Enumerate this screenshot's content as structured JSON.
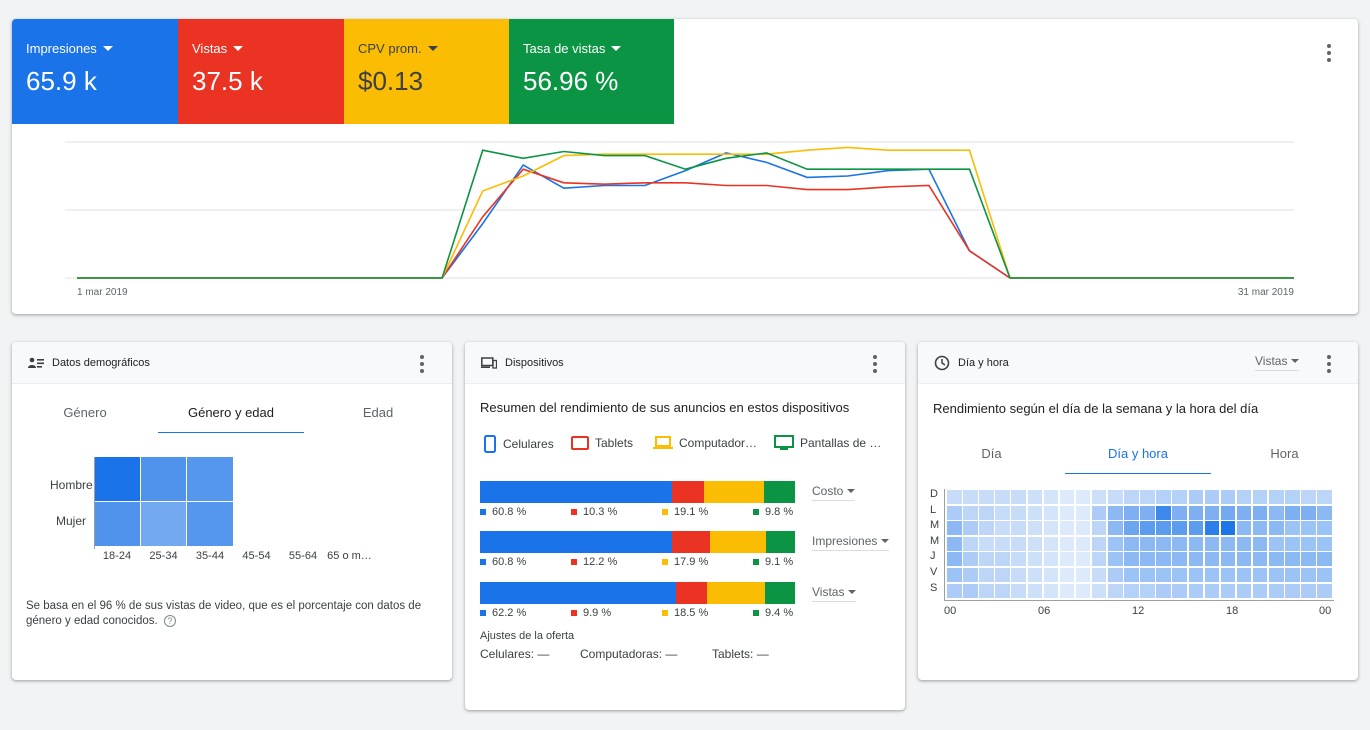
{
  "metrics": [
    {
      "label": "Impresiones",
      "value": "65.9 k",
      "color": "#1a73e8",
      "text_color": "#ffffff"
    },
    {
      "label": "Vistas",
      "value": "37.5 k",
      "color": "#ea3323",
      "text_color": "#ffffff"
    },
    {
      "label": "CPV prom.",
      "value": "$0.13",
      "color": "#fbbc04",
      "text_color": "#3c4043"
    },
    {
      "label": "Tasa de vistas",
      "value": "56.96 %",
      "color": "#0b9444",
      "text_color": "#ffffff"
    }
  ],
  "chart_data": {
    "type": "line",
    "x_start_label": "1 mar 2019",
    "x_end_label": "31 mar 2019",
    "x": [
      1,
      2,
      3,
      4,
      5,
      6,
      7,
      8,
      9,
      10,
      11,
      12,
      13,
      14,
      15,
      16,
      17,
      18,
      19,
      20,
      21,
      22,
      23,
      24,
      25,
      26,
      27,
      28,
      29,
      30,
      31
    ],
    "ylim": [
      0,
      1
    ],
    "series": [
      {
        "color": "#1a73e8",
        "values": [
          0,
          0,
          0,
          0,
          0,
          0,
          0,
          0,
          0,
          0,
          0.4,
          0.83,
          0.66,
          0.68,
          0.68,
          0.79,
          0.92,
          0.85,
          0.74,
          0.75,
          0.79,
          0.8,
          0.2,
          0,
          0,
          0,
          0,
          0,
          0,
          0,
          0
        ]
      },
      {
        "color": "#ea3323",
        "values": [
          0,
          0,
          0,
          0,
          0,
          0,
          0,
          0,
          0,
          0,
          0.45,
          0.8,
          0.7,
          0.69,
          0.7,
          0.7,
          0.68,
          0.68,
          0.65,
          0.65,
          0.67,
          0.68,
          0.2,
          0,
          0,
          0,
          0,
          0,
          0,
          0,
          0
        ]
      },
      {
        "color": "#fbbc04",
        "values": [
          0,
          0,
          0,
          0,
          0,
          0,
          0,
          0,
          0,
          0,
          0.64,
          0.75,
          0.9,
          0.91,
          0.91,
          0.91,
          0.91,
          0.91,
          0.94,
          0.96,
          0.94,
          0.94,
          0.94,
          0,
          0,
          0,
          0,
          0,
          0,
          0,
          0
        ]
      },
      {
        "color": "#0b9444",
        "values": [
          0,
          0,
          0,
          0,
          0,
          0,
          0,
          0,
          0,
          0,
          0.94,
          0.88,
          0.93,
          0.9,
          0.9,
          0.8,
          0.88,
          0.92,
          0.8,
          0.8,
          0.8,
          0.8,
          0.8,
          0,
          0,
          0,
          0,
          0,
          0,
          0,
          0
        ]
      }
    ]
  },
  "demo": {
    "title": "Datos demográficos",
    "tabs": [
      "Género",
      "Género y edad",
      "Edad"
    ],
    "rows": [
      "Hombre",
      "Mujer"
    ],
    "cols": [
      "18-24",
      "25-34",
      "35-44",
      "45-54",
      "55-64",
      "65 o m…"
    ],
    "heat": [
      [
        1.0,
        0.65,
        0.6,
        0,
        0,
        0
      ],
      [
        0.65,
        0.4,
        0.6,
        0,
        0,
        0
      ]
    ],
    "note": "Se basa en el 96 % de sus vistas de video, que es el porcentaje con datos de género y edad conocidos."
  },
  "devices": {
    "title": "Dispositivos",
    "subtitle": "Resumen del rendimiento de sus anuncios en estos dispositivos",
    "legend": [
      {
        "label": "Celulares",
        "color": "#1a73e8"
      },
      {
        "label": "Tablets",
        "color": "#ea3323"
      },
      {
        "label": "Computador…",
        "color": "#fbbc04"
      },
      {
        "label": "Pantallas de …",
        "color": "#0b9444"
      }
    ],
    "rows": [
      {
        "metric": "Costo",
        "values": [
          60.8,
          10.3,
          19.1,
          9.8
        ],
        "labels": [
          "60.8 %",
          "10.3 %",
          "19.1 %",
          "9.8 %"
        ]
      },
      {
        "metric": "Impresiones",
        "values": [
          60.8,
          12.2,
          17.9,
          9.1
        ],
        "labels": [
          "60.8 %",
          "12.2 %",
          "17.9 %",
          "9.1 %"
        ]
      },
      {
        "metric": "Vistas",
        "values": [
          62.2,
          9.9,
          18.5,
          9.4
        ],
        "labels": [
          "62.2 %",
          "9.9 %",
          "18.5 %",
          "9.4 %"
        ]
      }
    ],
    "bid_title": "Ajustes de la oferta",
    "bids": [
      "Celulares: —",
      "Computadoras: —",
      "Tablets: —"
    ]
  },
  "dayhour": {
    "title": "Día y hora",
    "metric_select": "Vistas",
    "subtitle": "Rendimiento según el día de la semana y la hora del día",
    "tabs": [
      "Día",
      "Día y hora",
      "Hora"
    ],
    "days": [
      "D",
      "L",
      "M",
      "M",
      "J",
      "V",
      "S"
    ],
    "hour_ticks": [
      "00",
      "06",
      "12",
      "18",
      "00"
    ],
    "heat": [
      [
        0.12,
        0.12,
        0.12,
        0.12,
        0.12,
        0.1,
        0.08,
        0.05,
        0.05,
        0.1,
        0.12,
        0.15,
        0.15,
        0.18,
        0.18,
        0.2,
        0.2,
        0.2,
        0.18,
        0.18,
        0.18,
        0.18,
        0.15,
        0.15
      ],
      [
        0.2,
        0.15,
        0.15,
        0.12,
        0.12,
        0.1,
        0.08,
        0.05,
        0.05,
        0.2,
        0.3,
        0.35,
        0.35,
        0.55,
        0.35,
        0.35,
        0.35,
        0.38,
        0.35,
        0.35,
        0.3,
        0.35,
        0.35,
        0.3
      ],
      [
        0.3,
        0.2,
        0.15,
        0.12,
        0.12,
        0.1,
        0.08,
        0.05,
        0.05,
        0.15,
        0.3,
        0.4,
        0.45,
        0.45,
        0.45,
        0.45,
        0.6,
        0.65,
        0.3,
        0.3,
        0.3,
        0.25,
        0.25,
        0.25
      ],
      [
        0.3,
        0.15,
        0.12,
        0.12,
        0.12,
        0.1,
        0.08,
        0.05,
        0.05,
        0.15,
        0.25,
        0.3,
        0.3,
        0.3,
        0.3,
        0.3,
        0.3,
        0.3,
        0.3,
        0.3,
        0.25,
        0.25,
        0.25,
        0.25
      ],
      [
        0.3,
        0.2,
        0.15,
        0.15,
        0.12,
        0.1,
        0.08,
        0.05,
        0.05,
        0.15,
        0.25,
        0.3,
        0.3,
        0.3,
        0.3,
        0.3,
        0.3,
        0.3,
        0.3,
        0.3,
        0.3,
        0.3,
        0.3,
        0.3
      ],
      [
        0.25,
        0.2,
        0.15,
        0.15,
        0.12,
        0.1,
        0.08,
        0.05,
        0.05,
        0.12,
        0.2,
        0.25,
        0.25,
        0.25,
        0.25,
        0.25,
        0.25,
        0.25,
        0.25,
        0.25,
        0.25,
        0.25,
        0.25,
        0.25
      ],
      [
        0.2,
        0.2,
        0.15,
        0.15,
        0.12,
        0.1,
        0.08,
        0.05,
        0.05,
        0.1,
        0.15,
        0.18,
        0.18,
        0.2,
        0.2,
        0.2,
        0.2,
        0.2,
        0.2,
        0.2,
        0.2,
        0.2,
        0.2,
        0.2
      ]
    ]
  }
}
